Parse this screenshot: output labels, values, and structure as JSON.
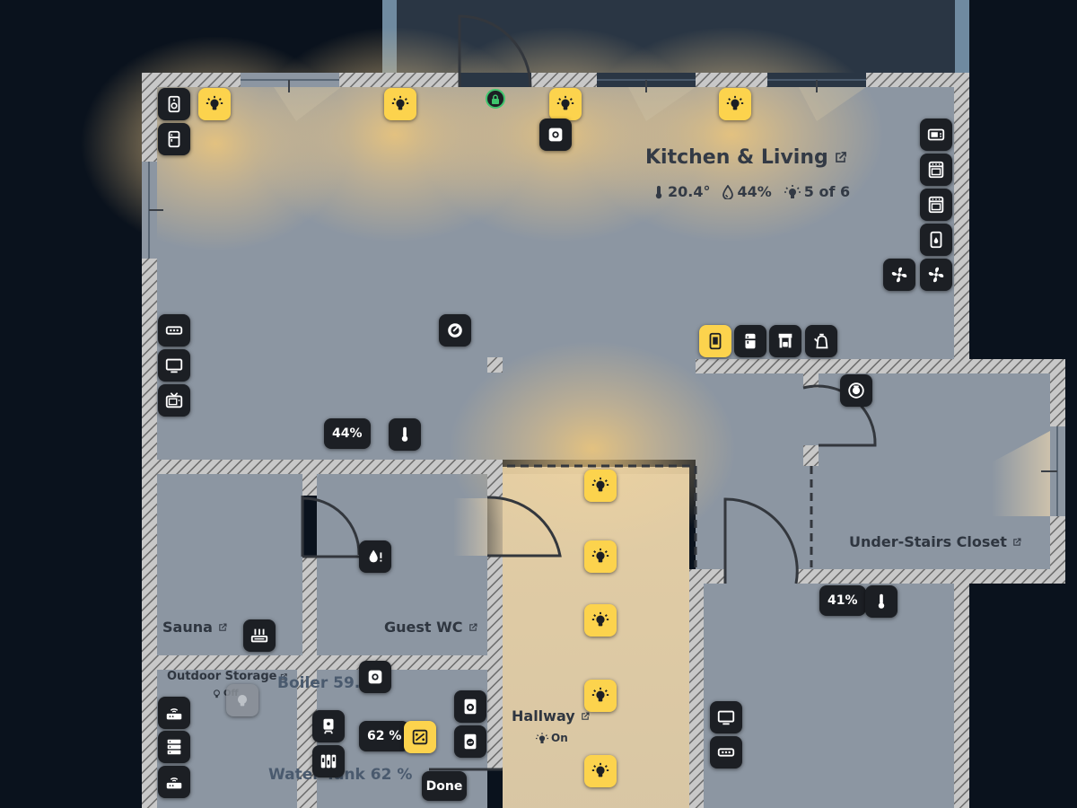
{
  "colors": {
    "background": "#0a121d",
    "floor": "#8c96a2",
    "wall": "#bcbcbc",
    "light_on": "#fcd34d",
    "button": "#1c1f24",
    "lock_ok": "#3ec46d"
  },
  "rooms": {
    "kitchen_living": {
      "name": "Kitchen & Living",
      "temperature": "20.4°",
      "humidity": "44%",
      "lights": "5 of 6"
    },
    "under_stairs": {
      "name": "Under-Stairs Closet"
    },
    "sauna": {
      "name": "Sauna"
    },
    "guest_wc": {
      "name": "Guest WC"
    },
    "outdoor_storage": {
      "name": "Outdoor Storage",
      "state": "Off"
    },
    "hallway": {
      "name": "Hallway",
      "state": "On"
    }
  },
  "readouts": {
    "living_humidity": "44%",
    "closet_humidity": "41%",
    "water_tank": "62 %",
    "boiler_ghost": "Boiler 59.0",
    "water_tank_ghost": "Water Tank 62 %"
  },
  "buttons": {
    "done": "Done"
  },
  "icons": {
    "light": "lightbulb-icon",
    "speaker": "speaker-icon",
    "fridge": "fridge-icon",
    "oven": "oven-icon",
    "fan": "fan-icon",
    "tv": "tv-icon",
    "thermometer": "thermometer-icon",
    "router": "router-icon",
    "server": "server-icon",
    "washer": "washing-machine-icon",
    "lock": "lock-icon"
  }
}
